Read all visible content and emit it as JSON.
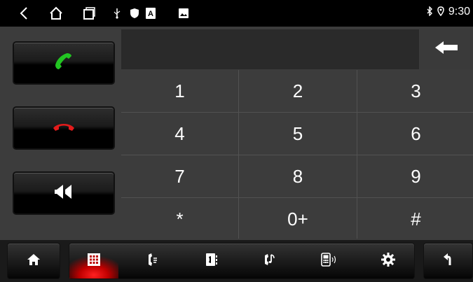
{
  "status_bar": {
    "time": "9:30",
    "nav_icons": [
      "back-icon",
      "home-icon",
      "recents-icon"
    ],
    "notification_icons": [
      "usb-icon",
      "shield-icon",
      "a-box-icon",
      "image-icon"
    ],
    "right_icons": [
      "bluetooth-icon",
      "location-icon"
    ]
  },
  "call_controls": [
    {
      "name": "answer-call-button",
      "icon": "phone-answer-icon",
      "color": "#22c522"
    },
    {
      "name": "end-call-button",
      "icon": "phone-hangup-icon",
      "color": "#e31b1b"
    },
    {
      "name": "volume-button",
      "icon": "speaker-icon",
      "color": "#ffffff"
    }
  ],
  "display": {
    "value": ""
  },
  "keypad": {
    "keys": [
      "1",
      "2",
      "3",
      "4",
      "5",
      "6",
      "7",
      "8",
      "9",
      "*",
      "0+",
      "#"
    ]
  },
  "bottom_bar": {
    "items": [
      {
        "icon": "home-icon",
        "active": false
      },
      {
        "icon": "dialpad-icon",
        "active": true
      },
      {
        "icon": "call-log-icon",
        "active": false
      },
      {
        "icon": "contacts-icon",
        "active": false
      },
      {
        "icon": "music-phone-icon",
        "active": false
      },
      {
        "icon": "phone-device-icon",
        "active": false
      },
      {
        "icon": "settings-gear-icon",
        "active": false
      },
      {
        "icon": "return-icon",
        "active": false
      }
    ],
    "accent_color": "#ff2020"
  }
}
